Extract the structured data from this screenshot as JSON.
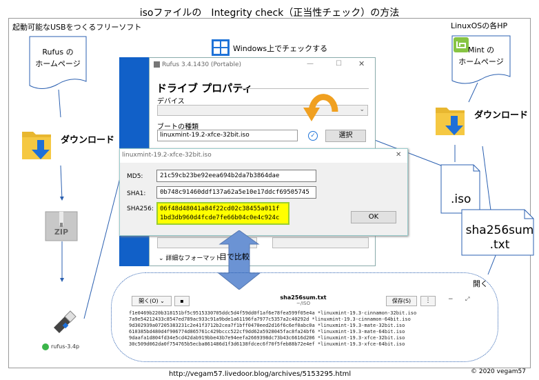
{
  "title": "isoファイルの　Integrity check（正当性チェック）の方法",
  "left": {
    "heading": "起動可能なUSBをつくるフリーソフト",
    "doc_text": [
      "Rufus の",
      "ホームページ"
    ],
    "download_label": "ダウンロード",
    "zip_label": "ZIP",
    "app_label": "rufus-3.4p"
  },
  "center": {
    "windows_label": "Windows上でチェックする",
    "rufus": {
      "window_title": "Rufus 3.4.1430 (Portable)",
      "heading": "ドライブ プロパティ",
      "device_label": "デバイス",
      "boot_type_label": "ブートの種類",
      "boot_value": "linuxmint-19.2-xfce-32bit.iso",
      "select_button": "選択",
      "detail_format": "詳細なフォーマット"
    },
    "checksum": {
      "window_title": "linuxmint-19.2-xfce-32bit.iso",
      "md5_label": "MD5:",
      "md5_value": "21c59cb23be92eea694b2da7b3864dae",
      "sha1_label": "SHA1:",
      "sha1_value": "0b748c91460ddf137a62a5e10e17ddcf69505745",
      "sha256_label": "SHA256:",
      "sha256_line1": "06f48d48041a84f22cd02c38455a011f",
      "sha256_line2": "1bd3db960d4fcde7fe66b04c0e4c924c",
      "ok_button": "OK"
    },
    "compare_label": "目で比較"
  },
  "right": {
    "heading": "LinuxOSの各HP",
    "doc_text": [
      "Mint の",
      "ホームページ"
    ],
    "download_label": "ダウンロード",
    "iso_label": ".iso",
    "sha_label_1": "sha256sum",
    "sha_label_2": ".txt",
    "open_label": "開く"
  },
  "editor": {
    "open_button": "開く(O)",
    "file_title": "sha256sum.txt",
    "file_path": "~/ISO",
    "save_button": "保存(S)",
    "lines": [
      "f1e0469b220b318151bf5c9515330705ddc5d4f59dd0f1af6e78fea599f05e4a *linuxmint-19.3-cinnamon-32bit.iso",
      "7a9e54212433c8547ed789ac933c91a9bde1a61196fa7977c5357a2c40292d *linuxmint-19.3-cinnamon-64bit.iso",
      "9d302939a07205383231c2e41f3712b2cea7f1bff0470eed2d16f6c6ef0abc0a *linuxmint-19.3-mate-32bit.iso",
      "610385bd480d4f906774d865761c429bccc522cf9dd62a5928045fac8fa24bf6 *linuxmint-19.3-mate-64bit.iso",
      "9daafa1d804fd34e5cd42dab919bbe43b7e94eefa2669398dc73b43c6616d206 *linuxmint-19.3-xfce-32bit.iso",
      "30c509d062da0f754765b5ecba861486d1f3d6138fdcec6f70f5feb88b72e4ef *linuxmint-19.3-xfce-64bit.iso"
    ]
  },
  "footer": {
    "url": "http://vegam57.livedoor.blog/archives/5153295.html",
    "copyright": "© 2020 vegam57"
  },
  "colors": {
    "windows_blue": "#1160c8",
    "highlight_yellow": "#ffff00",
    "highlight_border": "#9acd32",
    "arrow_blue": "#6b93d4",
    "orange": "#f0a020",
    "folder_yellow": "#f5c842",
    "mint_green": "#87c443"
  }
}
